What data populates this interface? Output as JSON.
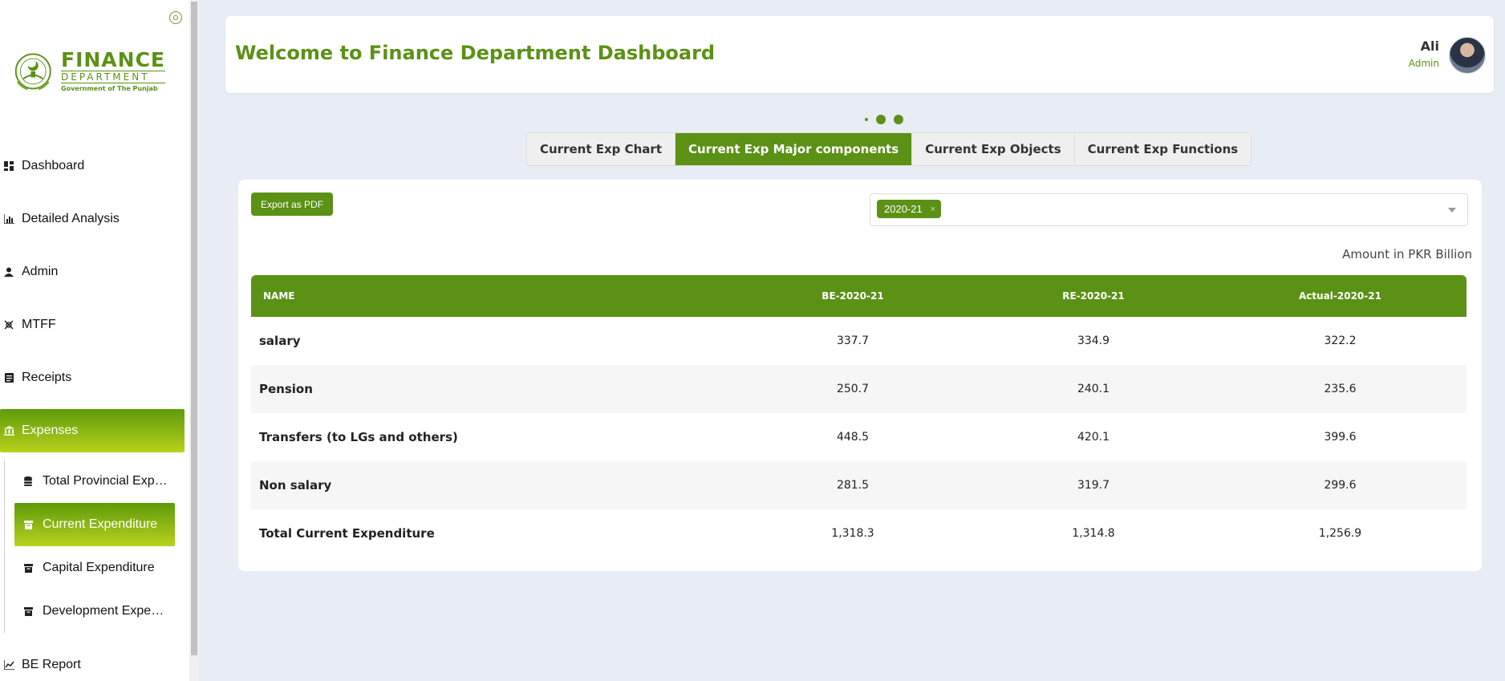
{
  "app": {
    "logo": {
      "title": "FINANCE",
      "subtitle": "DEPARTMENT",
      "tagline": "Government of The Punjab"
    }
  },
  "sidebar": {
    "items": [
      {
        "label": "Dashboard",
        "icon": "dashboard-icon"
      },
      {
        "label": "Detailed Analysis",
        "icon": "bar-chart-icon"
      },
      {
        "label": "Admin",
        "icon": "user-icon"
      },
      {
        "label": "MTFF",
        "icon": "mtff-icon"
      },
      {
        "label": "Receipts",
        "icon": "receipt-icon"
      },
      {
        "label": "Expenses",
        "icon": "bank-icon",
        "active": true
      }
    ],
    "subitems": [
      {
        "label": "Total Provincial Exp…",
        "icon": "coins-icon"
      },
      {
        "label": "Current Expenditure",
        "icon": "archive-icon",
        "active": true
      },
      {
        "label": "Capital Expenditure",
        "icon": "archive-icon"
      },
      {
        "label": "Development Expe…",
        "icon": "archive-icon"
      }
    ],
    "bottom_item": {
      "label": "BE Report",
      "icon": "line-chart-icon"
    }
  },
  "header": {
    "title": "Welcome to Finance Department Dashboard",
    "user_name": "Ali",
    "user_role": "Admin"
  },
  "tabs": [
    {
      "label": "Current Exp Chart"
    },
    {
      "label": "Current Exp Major components",
      "active": true
    },
    {
      "label": "Current Exp Objects"
    },
    {
      "label": "Current Exp Functions"
    }
  ],
  "card": {
    "export_label": "Export as PDF",
    "selected_year": "2020-21",
    "chip_remove": "×",
    "amount_note": "Amount in PKR Billion"
  },
  "table": {
    "headers": [
      "NAME",
      "BE-2020-21",
      "RE-2020-21",
      "Actual-2020-21"
    ],
    "rows": [
      [
        "salary",
        "337.7",
        "334.9",
        "322.2"
      ],
      [
        "Pension",
        "250.7",
        "240.1",
        "235.6"
      ],
      [
        "Transfers (to LGs and others)",
        "448.5",
        "420.1",
        "399.6"
      ],
      [
        "Non salary",
        "281.5",
        "319.7",
        "299.6"
      ],
      [
        "Total Current Expenditure",
        "1,318.3",
        "1,314.8",
        "1,256.9"
      ]
    ]
  },
  "colors": {
    "accent": "#5b9115",
    "gradient_end": "#b8d21e",
    "background": "#e8edf5"
  }
}
